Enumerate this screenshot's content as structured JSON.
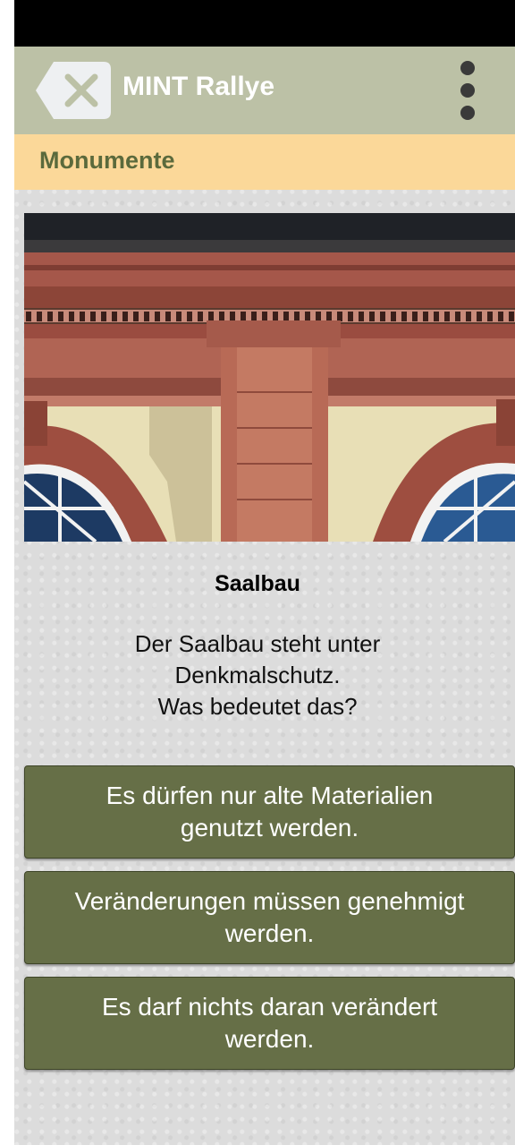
{
  "toolbar": {
    "close_icon": "close-icon",
    "title": "MINT Rallye",
    "menu_icon": "more-vert-icon",
    "bg_color": "#bcc1a6"
  },
  "section": {
    "title": "Monumente",
    "bg_color": "#fbd899",
    "text_color": "#5b6a3c"
  },
  "question": {
    "image_alt": "Saalbau facade",
    "title": "Saalbau",
    "text_lines": [
      "Der Saalbau steht unter",
      "Denkmalschutz.",
      "Was bedeutet das?"
    ]
  },
  "answers": [
    {
      "lines": [
        "Es dürfen nur alte Materialien",
        "genutzt werden."
      ]
    },
    {
      "lines": [
        "Veränderungen müssen genehmigt",
        "werden."
      ]
    },
    {
      "lines": [
        "Es darf nichts daran verändert",
        "werden."
      ]
    }
  ],
  "colors": {
    "answer_bg": "#666f47",
    "status_bar": "#000000"
  }
}
